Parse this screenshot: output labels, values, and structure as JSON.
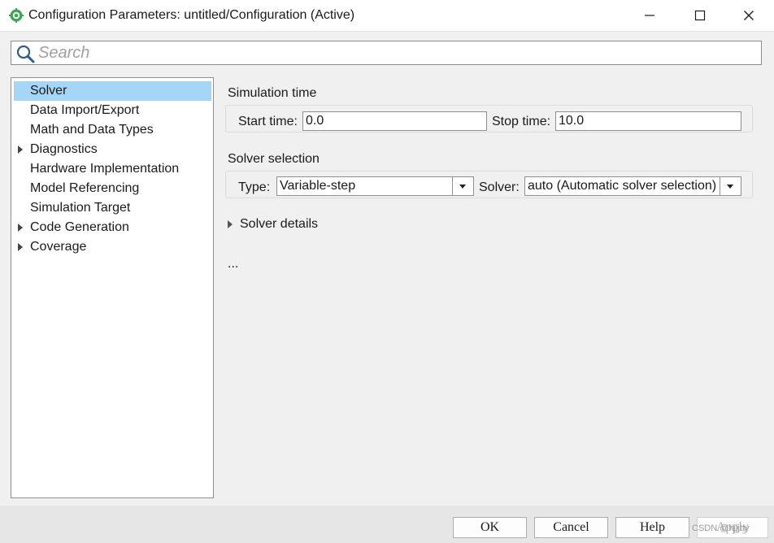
{
  "window": {
    "title": "Configuration Parameters: untitled/Configuration (Active)"
  },
  "search": {
    "placeholder": "Search"
  },
  "sidebar": {
    "items": [
      {
        "label": "Solver",
        "selected": true,
        "expandable": false
      },
      {
        "label": "Data Import/Export",
        "selected": false,
        "expandable": false
      },
      {
        "label": "Math and Data Types",
        "selected": false,
        "expandable": false
      },
      {
        "label": "Diagnostics",
        "selected": false,
        "expandable": true
      },
      {
        "label": "Hardware Implementation",
        "selected": false,
        "expandable": false
      },
      {
        "label": "Model Referencing",
        "selected": false,
        "expandable": false
      },
      {
        "label": "Simulation Target",
        "selected": false,
        "expandable": false
      },
      {
        "label": "Code Generation",
        "selected": false,
        "expandable": true
      },
      {
        "label": "Coverage",
        "selected": false,
        "expandable": true
      }
    ]
  },
  "main": {
    "simulation_time": {
      "title": "Simulation time",
      "start_label": "Start time:",
      "start_value": "0.0",
      "stop_label": "Stop time:",
      "stop_value": "10.0"
    },
    "solver_selection": {
      "title": "Solver selection",
      "type_label": "Type:",
      "type_value": "Variable-step",
      "solver_label": "Solver:",
      "solver_value": "auto (Automatic solver selection)"
    },
    "solver_details_label": "Solver details",
    "ellipsis": "..."
  },
  "buttons": {
    "ok": "OK",
    "cancel": "Cancel",
    "help": "Help",
    "apply": "Apply"
  },
  "watermark": "CSDN @hjjjtty",
  "colors": {
    "selection": "#a5d5f7",
    "window_bg": "#f0f0f0",
    "app_icon_green": "#3aa655"
  }
}
